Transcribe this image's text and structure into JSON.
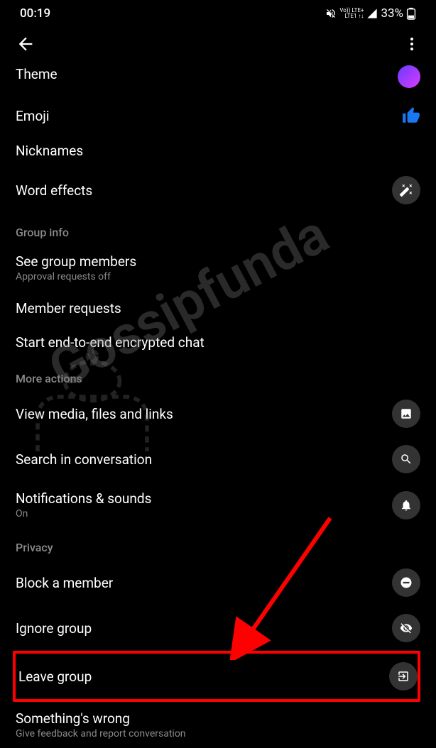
{
  "status": {
    "time": "00:19",
    "lte_top": "Vo)) LTE+",
    "lte_bottom": "LTE1 ↑↓",
    "battery": "33%"
  },
  "items": {
    "theme": "Theme",
    "emoji": "Emoji",
    "nicknames": "Nicknames",
    "wordEffects": "Word effects",
    "seeGroupMembers": "See group members",
    "approvalRequests": "Approval requests off",
    "memberRequests": "Member requests",
    "encryptedChat": "Start end-to-end encrypted chat",
    "viewMedia": "View media, files and links",
    "searchConv": "Search in conversation",
    "notifications": "Notifications  & sounds",
    "notificationsOn": "On",
    "blockMember": "Block a member",
    "ignoreGroup": "Ignore group",
    "leaveGroup": "Leave group",
    "somethingWrong": "Something's wrong",
    "feedback": "Give feedback and report conversation"
  },
  "sections": {
    "groupInfo": "Group info",
    "moreActions": "More actions",
    "privacy": "Privacy"
  },
  "watermark": "Gossipfunda"
}
